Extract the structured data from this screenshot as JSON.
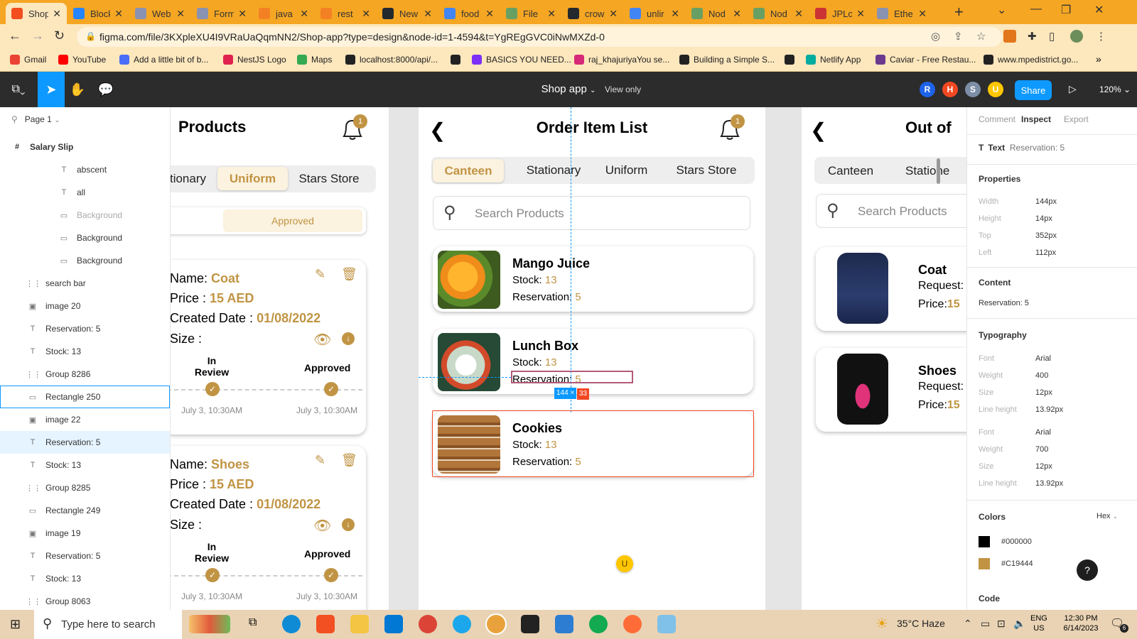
{
  "browser": {
    "tabs": [
      {
        "title": "Shop",
        "icon": "figma-icon",
        "color": "#f24e1e",
        "active": true
      },
      {
        "title": "Block",
        "icon": "bitbucket-icon",
        "color": "#2684ff"
      },
      {
        "title": "Web",
        "icon": "ethereum-icon",
        "color": "#8a92b2"
      },
      {
        "title": "Form",
        "icon": "ethereum-icon",
        "color": "#8a92b2"
      },
      {
        "title": "java",
        "icon": "stackoverflow-icon",
        "color": "#f48024"
      },
      {
        "title": "rest",
        "icon": "stackoverflow-icon",
        "color": "#f48024"
      },
      {
        "title": "New",
        "icon": "github-icon",
        "color": "#24292e"
      },
      {
        "title": "food",
        "icon": "google-icon",
        "color": "#4285f4"
      },
      {
        "title": "File",
        "icon": "nodejs-icon",
        "color": "#68a063"
      },
      {
        "title": "crow",
        "icon": "github-icon",
        "color": "#24292e"
      },
      {
        "title": "unlir",
        "icon": "google-icon",
        "color": "#4285f4"
      },
      {
        "title": "Nod",
        "icon": "npm-icon",
        "color": "#68a063"
      },
      {
        "title": "Nod",
        "icon": "npm-icon",
        "color": "#68a063"
      },
      {
        "title": "JPLo",
        "icon": "jsonplaceholder-icon",
        "color": "#cc3333"
      },
      {
        "title": "Ethe",
        "icon": "ethereum-icon",
        "color": "#8a92b2"
      }
    ],
    "url": "figma.com/file/3KXpleXU4I9VRaUaQqmNN2/Shop-app?type=design&node-id=1-4594&t=YgREgGVC0iNwMXZd-0",
    "bookmarks": [
      {
        "label": "Gmail",
        "color": "#ea4335"
      },
      {
        "label": "YouTube",
        "color": "#ff0000"
      },
      {
        "label": "Add a little bit of b...",
        "color": "#4a6cf7"
      },
      {
        "label": "NestJS Logo",
        "color": "#e0234e"
      },
      {
        "label": "Maps",
        "color": "#34a853"
      },
      {
        "label": "localhost:8000/api/...",
        "color": "#222222"
      },
      {
        "label": "",
        "color": "#222222"
      },
      {
        "label": "BASICS YOU NEED...",
        "color": "#7b2ff7"
      },
      {
        "label": "raj_khajuriyaYou se...",
        "color": "#d62976"
      },
      {
        "label": "Building a Simple S...",
        "color": "#222222"
      },
      {
        "label": "",
        "color": "#222222"
      },
      {
        "label": "Netlify App",
        "color": "#00ad9f"
      },
      {
        "label": "Caviar - Free Restau...",
        "color": "#6b3a8f"
      },
      {
        "label": "www.mpedistrict.go...",
        "color": "#222222"
      }
    ],
    "more": "»"
  },
  "figma": {
    "file_title": "Shop app",
    "view_only": "View only",
    "avatars": [
      {
        "letter": "R",
        "color": "#1e63e9"
      },
      {
        "letter": "H",
        "color": "#f24822"
      },
      {
        "letter": "S",
        "color": "#7c8da6"
      },
      {
        "letter": "U",
        "color": "#ffc700"
      }
    ],
    "share": "Share",
    "zoom": "120%",
    "page": "Page 1",
    "layers": [
      {
        "label": "Salary Slip",
        "icon": "#",
        "indent": 0,
        "bold": true
      },
      {
        "label": "abscent",
        "icon": "T",
        "indent": 3
      },
      {
        "label": "all",
        "icon": "T",
        "indent": 3
      },
      {
        "label": "Background",
        "icon": "▭",
        "indent": 3,
        "dim": true
      },
      {
        "label": "Background",
        "icon": "▭",
        "indent": 3
      },
      {
        "label": "Background",
        "icon": "▭",
        "indent": 3
      },
      {
        "label": "search bar",
        "icon": "⋮⋮",
        "indent": 1
      },
      {
        "label": "image 20",
        "icon": "▣",
        "indent": 1
      },
      {
        "label": "Reservation: 5",
        "icon": "T",
        "indent": 1
      },
      {
        "label": "Stock: 13",
        "icon": "T",
        "indent": 1
      },
      {
        "label": "Group 8286",
        "icon": "⋮⋮",
        "indent": 1
      },
      {
        "label": "Rectangle 250",
        "icon": "▭",
        "indent": 1,
        "hover": true
      },
      {
        "label": "image 22",
        "icon": "▣",
        "indent": 1
      },
      {
        "label": "Reservation: 5",
        "icon": "T",
        "indent": 1,
        "selected": true
      },
      {
        "label": "Stock: 13",
        "icon": "T",
        "indent": 1
      },
      {
        "label": "Group 8285",
        "icon": "⋮⋮",
        "indent": 1
      },
      {
        "label": "Rectangle 249",
        "icon": "▭",
        "indent": 1
      },
      {
        "label": "image 19",
        "icon": "▣",
        "indent": 1
      },
      {
        "label": "Reservation: 5",
        "icon": "T",
        "indent": 1
      },
      {
        "label": "Stock: 13",
        "icon": "T",
        "indent": 1
      },
      {
        "label": "Group 8063",
        "icon": "⋮⋮",
        "indent": 1
      }
    ],
    "inspect": {
      "tabs": [
        "Comment",
        "Inspect",
        "Export"
      ],
      "active_tab": "Inspect",
      "node_type": "Text",
      "node_name": "Reservation: 5",
      "properties_title": "Properties",
      "properties": [
        {
          "label": "Width",
          "value": "144px"
        },
        {
          "label": "Height",
          "value": "14px"
        },
        {
          "label": "Top",
          "value": "352px"
        },
        {
          "label": "Left",
          "value": "112px"
        }
      ],
      "content_title": "Content",
      "content": "Reservation: 5",
      "typography_title": "Typography",
      "typography": [
        {
          "label": "Font",
          "value": "Arial"
        },
        {
          "label": "Weight",
          "value": "400"
        },
        {
          "label": "Size",
          "value": "12px"
        },
        {
          "label": "Line height",
          "value": "13.92px"
        },
        {
          "label": "Font",
          "value": "Arial"
        },
        {
          "label": "Weight",
          "value": "700"
        },
        {
          "label": "Size",
          "value": "12px"
        },
        {
          "label": "Line height",
          "value": "13.92px"
        }
      ],
      "colors_title": "Colors",
      "color_format": "Hex",
      "colors": [
        "#000000",
        "#C19444"
      ],
      "code_title": "Code",
      "help": "?"
    },
    "measure": {
      "width": "144",
      "height": "33"
    }
  },
  "frame_products": {
    "title": "Products",
    "badge": "1",
    "tabs": [
      "tionary",
      "Uniform",
      "Stars Store"
    ],
    "active_tab": "Uniform",
    "status_tab": "Approved",
    "items": [
      {
        "name_label": "Name: ",
        "name": "Coat",
        "price_label": "Price : ",
        "price": "15 AED",
        "date_label": "Created Date : ",
        "date": "01/08/2022",
        "size_label": "Size :",
        "step1": "In Review",
        "step2": "Approved",
        "time1": "July 3, 10:30AM",
        "time2": "July 3, 10:30AM"
      },
      {
        "name_label": "Name: ",
        "name": "Shoes",
        "price_label": "Price : ",
        "price": "15 AED",
        "date_label": "Created Date : ",
        "date": "01/08/2022",
        "size_label": "Size :",
        "step1": "In Review",
        "step2": "Approved",
        "time1": "July 3, 10:30AM",
        "time2": "July 3, 10:30AM"
      }
    ]
  },
  "frame_orders": {
    "title": "Order Item List",
    "badge": "1",
    "tabs": [
      "Canteen",
      "Stationary",
      "Uniform",
      "Stars Store"
    ],
    "active_tab": "Canteen",
    "search_placeholder": "Search Products",
    "stock_label": "Stock: ",
    "reservation_label": "Reservation: ",
    "items": [
      {
        "name": "Mango Juice",
        "stock": "13",
        "reservation": "5"
      },
      {
        "name": "Lunch Box",
        "stock": "13",
        "reservation": "5"
      },
      {
        "name": "Cookies",
        "stock": "13",
        "reservation": "5"
      }
    ],
    "cursor_avatar": "U"
  },
  "frame_outofstock": {
    "title": "Out of",
    "tabs": [
      "Canteen",
      "Statione"
    ],
    "search_placeholder": "Search Products",
    "items": [
      {
        "name": "Coat",
        "request": "Request:",
        "price": "Price:",
        "price_val": "15"
      },
      {
        "name": "Shoes",
        "request": "Request:",
        "price": "Price:",
        "price_val": "15"
      }
    ]
  },
  "taskbar": {
    "search_placeholder": "Type here to search",
    "weather": "35°C  Haze",
    "lang_line1": "ENG",
    "lang_line2": "US",
    "time": "12:30 PM",
    "date": "6/14/2023",
    "notif": "6"
  }
}
